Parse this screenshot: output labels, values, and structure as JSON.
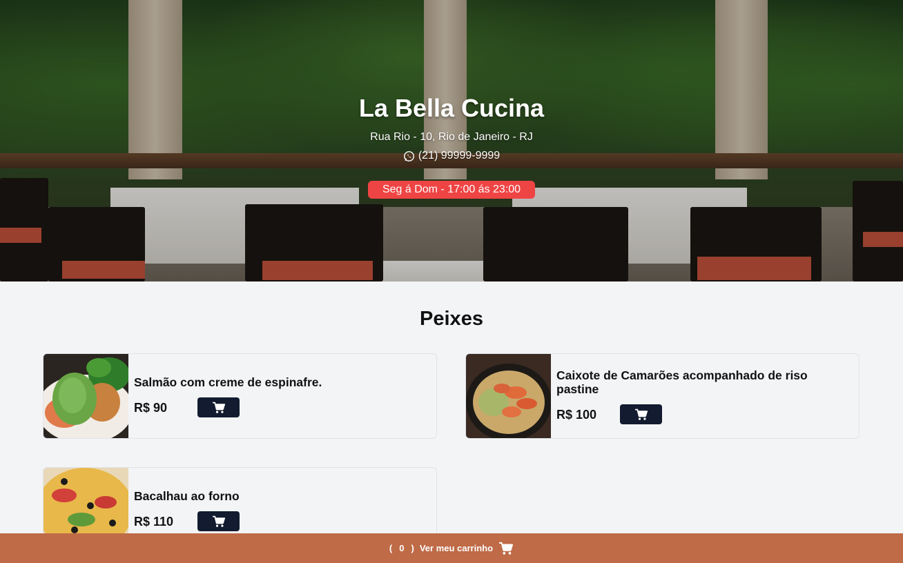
{
  "restaurant": {
    "name": "La Bella Cucina",
    "address": "Rua Rio - 10, Rio de Janeiro - RJ",
    "phone": "(21) 99999-9999",
    "hours": "Seg á Dom - 17:00 ás 23:00",
    "phone_icon": "whatsapp-icon"
  },
  "section": {
    "title": "Peixes"
  },
  "items": [
    {
      "name": "Salmão com creme de espinafre.",
      "price": "R$ 90",
      "image": "salmon-dish-photo"
    },
    {
      "name": "Caixote de Camarões acompanhado de riso pastine",
      "price": "R$ 100",
      "image": "shrimp-dish-photo"
    },
    {
      "name": "Bacalhau ao forno",
      "price": "R$ 110",
      "image": "cod-dish-photo"
    }
  ],
  "cart": {
    "open_paren": "(",
    "count": "0",
    "close_paren": ")",
    "label": "Ver meu carrinho",
    "icon": "cart-icon"
  },
  "colors": {
    "hours_badge": "#ef4444",
    "cart_button": "#121b2f",
    "footer": "#bf6b47",
    "background": "#f3f4f6"
  }
}
